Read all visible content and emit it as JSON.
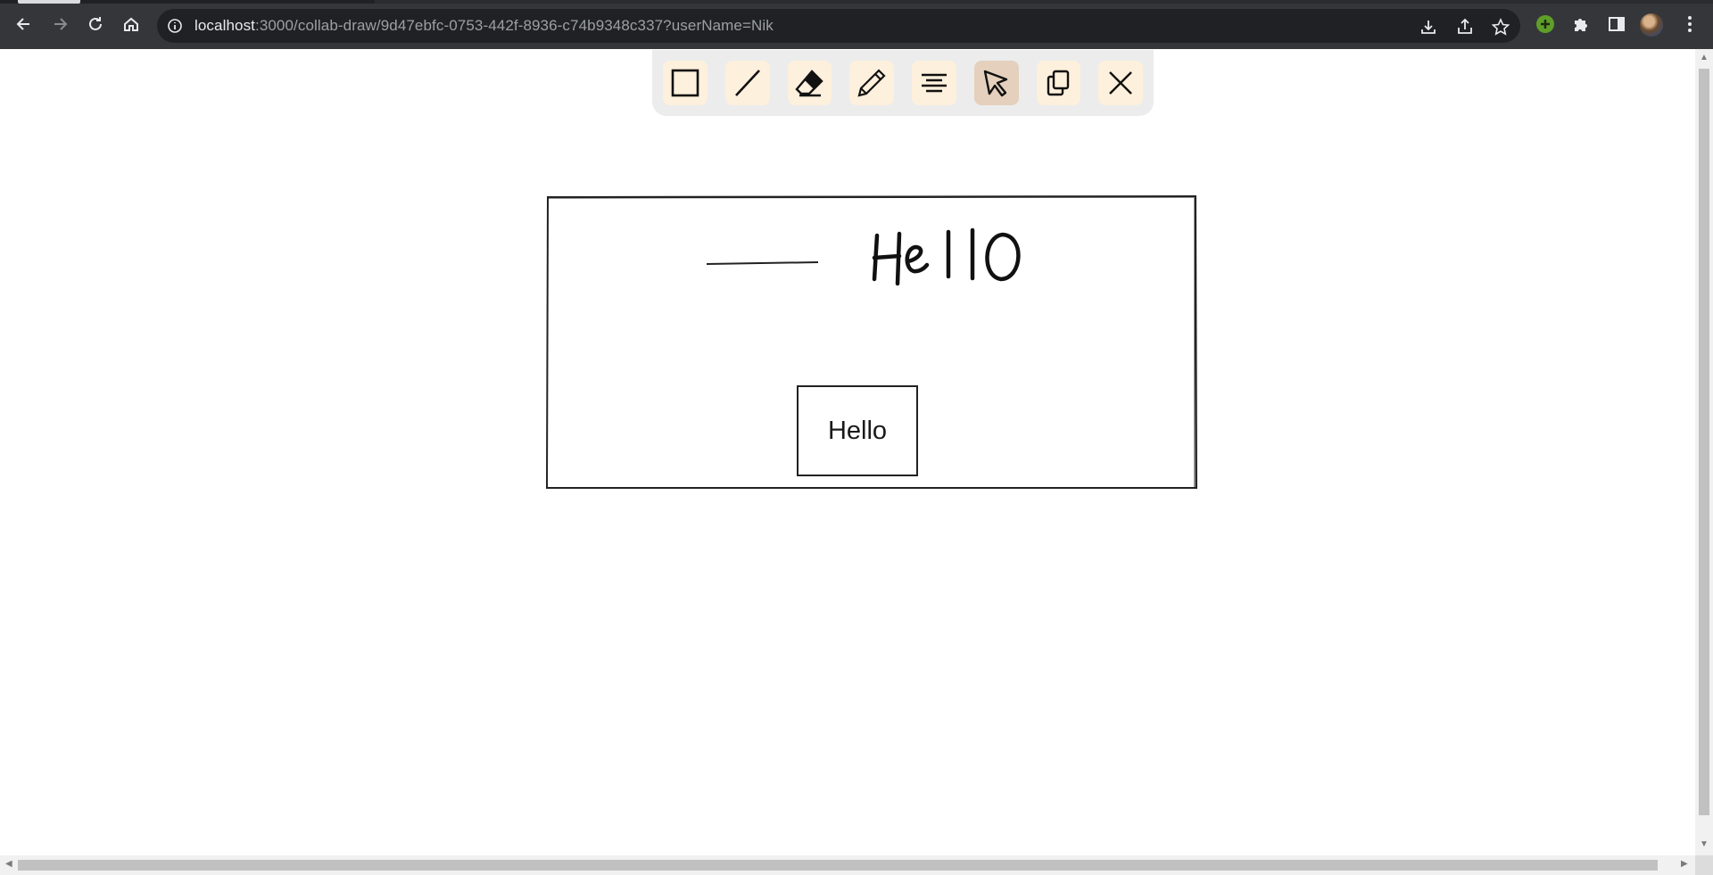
{
  "browser": {
    "url_host": "localhost",
    "url_rest": ":3000/collab-draw/9d47ebfc-0753-442f-8936-c74b9348c337?userName=Nik"
  },
  "toolbar": {
    "tools": [
      {
        "name": "rectangle",
        "icon": "rectangle-icon"
      },
      {
        "name": "line",
        "icon": "line-icon"
      },
      {
        "name": "eraser",
        "icon": "eraser-icon"
      },
      {
        "name": "pencil",
        "icon": "pencil-icon"
      },
      {
        "name": "text",
        "icon": "text-align-icon"
      },
      {
        "name": "select",
        "icon": "cursor-icon",
        "selected": true
      },
      {
        "name": "copy",
        "icon": "copy-icon"
      },
      {
        "name": "clear",
        "icon": "close-icon"
      }
    ],
    "tool_bg": "#fdf0dc",
    "selected_bg": "#e4d0bc"
  },
  "canvas": {
    "handwritten_text": "Hello",
    "text_box_label": "Hello"
  }
}
